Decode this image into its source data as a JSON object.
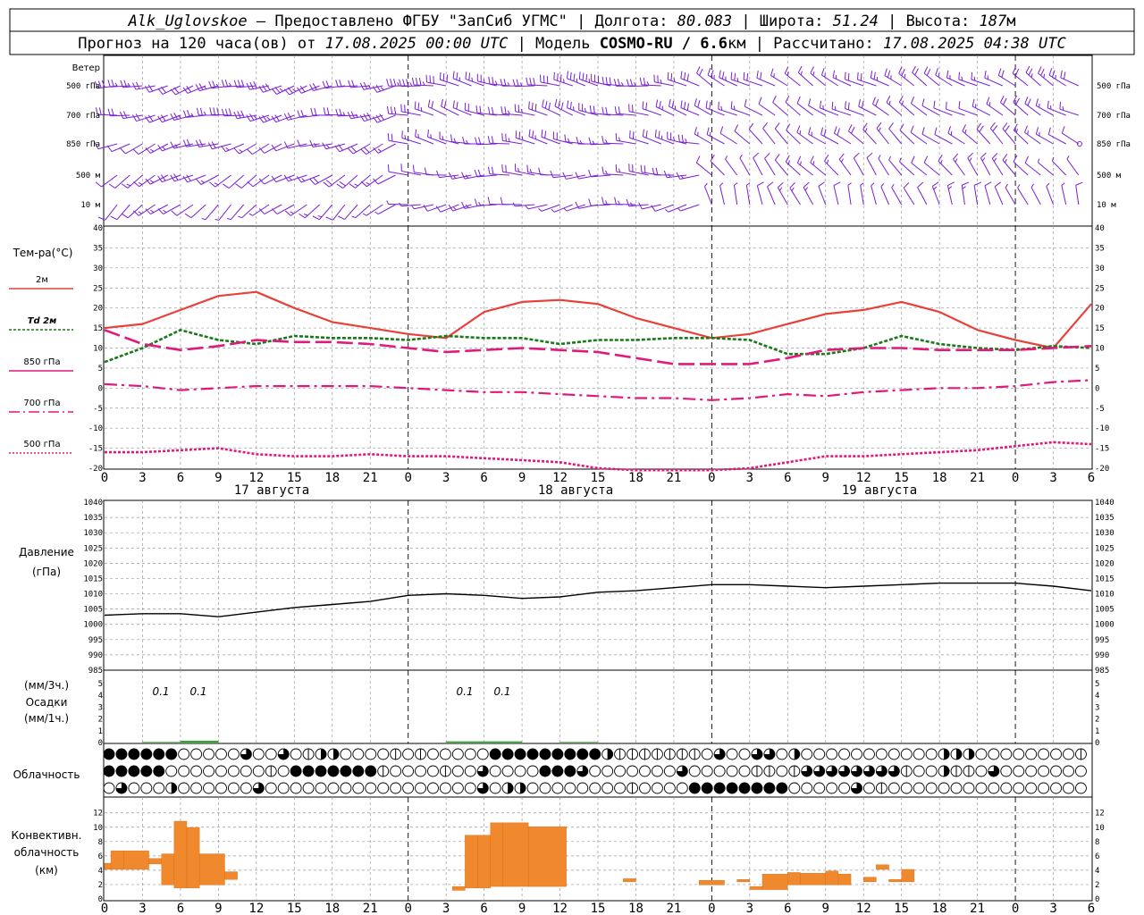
{
  "header": {
    "station": "Alk_Uglovskoe",
    "provider": " – Предоставлено ФГБУ \"ЗапСиб УГМС\" | Долгота: ",
    "lon": "80.083",
    "lat_label": " | Широта: ",
    "lat": "51.24",
    "alt_label": " | Высота: ",
    "alt": "187",
    "alt_unit": "м",
    "line2_a": "Прогноз на 120 часа(ов) от ",
    "run_time": "17.08.2025 00:00 UTC",
    "line2_b": " | Модель ",
    "model": "COSMO-RU / 6.6",
    "model_unit": "км",
    "line2_c": " | Рассчитано: ",
    "calc_time": "17.08.2025 04:38 UTC"
  },
  "wind_panel": {
    "title": "Ветер",
    "levels": [
      "500 гПа",
      "700 гПа",
      "850 гПа",
      "500 м",
      "10 м"
    ],
    "color": "#7a1fd6"
  },
  "temp_panel": {
    "title": "Тем-ра(°C)",
    "legend": [
      {
        "label": "2м",
        "color": "#e8413a"
      },
      {
        "label": "Td 2м",
        "color": "#1a7a1a"
      },
      {
        "label": "850 гПа",
        "color": "#e0197a"
      },
      {
        "label": "700 гПа",
        "color": "#e0197a"
      },
      {
        "label": "500 гПа",
        "color": "#e0197a"
      }
    ],
    "yticks": [
      "40",
      "35",
      "30",
      "25",
      "20",
      "15",
      "10",
      "5",
      "0",
      "-5",
      "-10",
      "-15",
      "-20"
    ]
  },
  "pressure_panel": {
    "title1": "Давление",
    "title2": "(гПа)",
    "yticks": [
      "1040",
      "1035",
      "1030",
      "1025",
      "1020",
      "1015",
      "1010",
      "1005",
      "1000",
      "995",
      "990",
      "985"
    ]
  },
  "precip_panel": {
    "title1": "(мм/3ч.)",
    "title2": "Осадки",
    "title3": "(мм/1ч.)",
    "yticks": [
      "5",
      "4",
      "3",
      "2",
      "1",
      "0"
    ],
    "labels": [
      "0.1",
      "0.1",
      "0.1",
      "0.1"
    ]
  },
  "cloud_panel": {
    "title": "Облачность"
  },
  "conv_panel": {
    "title1": "Конвективн.",
    "title2": "облачность",
    "title3": "(км)",
    "yticks": [
      "12",
      "10",
      "8",
      "6",
      "4",
      "2",
      "0"
    ],
    "color": "#f0892e"
  },
  "x_axis": {
    "ticks": [
      "0",
      "3",
      "6",
      "9",
      "12",
      "15",
      "18",
      "21",
      "0",
      "3",
      "6",
      "9",
      "12",
      "15",
      "18",
      "21",
      "0",
      "3",
      "6",
      "9",
      "12",
      "15",
      "18",
      "21",
      "0",
      "3",
      "6"
    ],
    "days": [
      "17 августа",
      "18 августа",
      "19 августа"
    ]
  },
  "chart_data": [
    {
      "type": "line",
      "title": "Тем-ра(°C)",
      "ylim": [
        -20,
        40
      ],
      "x_hours": [
        0,
        3,
        6,
        9,
        12,
        15,
        18,
        21,
        24,
        27,
        30,
        33,
        36,
        39,
        42,
        45,
        48,
        51,
        54,
        57,
        60,
        63,
        66,
        69,
        72,
        75,
        78
      ],
      "series": [
        {
          "name": "2м",
          "values": [
            15,
            16,
            19.5,
            23,
            24,
            20,
            16.5,
            15,
            13.5,
            12.5,
            19,
            21.5,
            22,
            21,
            17.5,
            15,
            12.5,
            13.5,
            16,
            18.5,
            19.5,
            21.5,
            19,
            14.5,
            12,
            10,
            21
          ]
        },
        {
          "name": "Td 2м",
          "values": [
            6.5,
            10,
            14.5,
            12,
            11,
            13,
            12.5,
            12.5,
            12,
            13,
            12.5,
            12.5,
            11,
            12,
            12,
            12.5,
            12.5,
            12,
            8.5,
            8.5,
            10,
            13,
            11,
            10,
            9.5,
            10.5,
            10
          ]
        },
        {
          "name": "850 гПа",
          "values": [
            14.5,
            11,
            9.5,
            10.5,
            12,
            11.5,
            11.5,
            11,
            10,
            9,
            9.5,
            10,
            9.5,
            9,
            7.5,
            6,
            6,
            6,
            7.5,
            9.5,
            10,
            10,
            9.5,
            9.5,
            9.5,
            10,
            10.5
          ]
        },
        {
          "name": "700 гПа",
          "values": [
            1,
            0.5,
            -0.5,
            0,
            0.5,
            0.5,
            0.5,
            0.5,
            0,
            -0.5,
            -1,
            -1,
            -1.5,
            -2,
            -2.5,
            -2.5,
            -3,
            -2.5,
            -1.5,
            -2,
            -1,
            -0.5,
            0,
            0,
            0.5,
            1.5,
            2
          ]
        },
        {
          "name": "500 гПа",
          "values": [
            -16,
            -16,
            -15.5,
            -15,
            -16.5,
            -17,
            -17,
            -16.5,
            -17,
            -17,
            -17.5,
            -18,
            -18.5,
            -20,
            -21,
            -21,
            -21,
            -20,
            -18.5,
            -17,
            -17,
            -16.5,
            -16,
            -15.5,
            -14.5,
            -13.5,
            -14
          ]
        }
      ]
    },
    {
      "type": "line",
      "title": "Давление",
      "ylabel": "(гПа)",
      "ylim": [
        985,
        1040
      ],
      "x_hours": [
        0,
        3,
        6,
        9,
        12,
        15,
        18,
        21,
        24,
        27,
        30,
        33,
        36,
        39,
        42,
        45,
        48,
        51,
        54,
        57,
        60,
        63,
        66,
        69,
        72,
        75,
        78
      ],
      "values": [
        1003,
        1003.5,
        1003.5,
        1002.5,
        1004,
        1005.5,
        1006.5,
        1007.5,
        1009.5,
        1010,
        1009.5,
        1008.5,
        1009,
        1010.5,
        1011,
        1012,
        1013,
        1013,
        1012.5,
        1012,
        1012.5,
        1013,
        1013.5,
        1013.5,
        1013.5,
        1012.5,
        1011
      ]
    },
    {
      "type": "bar",
      "title": "Осадки",
      "ylabel": "(мм/3ч.)",
      "ylim": [
        0,
        5
      ],
      "x_hours": [
        3,
        6,
        27,
        30,
        36
      ],
      "values": [
        0.05,
        0.15,
        0.1,
        0.1,
        0.05
      ],
      "labels": [
        {
          "x_hour": 4.5,
          "text": "0.1"
        },
        {
          "x_hour": 7.5,
          "text": "0.1"
        },
        {
          "x_hour": 28.5,
          "text": "0.1"
        },
        {
          "x_hour": 31.5,
          "text": "0.1"
        }
      ]
    },
    {
      "type": "bar",
      "title": "Конвективн. облачность",
      "ylabel": "(км)",
      "ylim": [
        0,
        13
      ],
      "bars": [
        {
          "x0": 0,
          "x1": 0.5,
          "bottom": 3.8,
          "top": 4.6
        },
        {
          "x0": 0.5,
          "x1": 1.5,
          "bottom": 3.8,
          "top": 6.2
        },
        {
          "x0": 1.5,
          "x1": 3.5,
          "bottom": 3.8,
          "top": 6.2
        },
        {
          "x0": 3.5,
          "x1": 4.5,
          "bottom": 4.5,
          "top": 5.2
        },
        {
          "x0": 4.5,
          "x1": 5.5,
          "bottom": 1.8,
          "top": 5.8
        },
        {
          "x0": 5.5,
          "x1": 6.5,
          "bottom": 1.4,
          "top": 10
        },
        {
          "x0": 6.5,
          "x1": 7.5,
          "bottom": 1.4,
          "top": 9.2
        },
        {
          "x0": 7.5,
          "x1": 9.5,
          "bottom": 1.8,
          "top": 5.8
        },
        {
          "x0": 9.5,
          "x1": 10.5,
          "bottom": 2.5,
          "top": 3.5
        },
        {
          "x0": 27.5,
          "x1": 28.5,
          "bottom": 1.1,
          "top": 1.6
        },
        {
          "x0": 28.5,
          "x1": 29.5,
          "bottom": 1.4,
          "top": 8.2
        },
        {
          "x0": 29.5,
          "x1": 30.5,
          "bottom": 1.4,
          "top": 8.2
        },
        {
          "x0": 30.5,
          "x1": 31.5,
          "bottom": 1.6,
          "top": 9.8
        },
        {
          "x0": 31.5,
          "x1": 33.5,
          "bottom": 1.6,
          "top": 9.8
        },
        {
          "x0": 33.5,
          "x1": 36.5,
          "bottom": 1.6,
          "top": 9.3
        },
        {
          "x0": 41,
          "x1": 42,
          "bottom": 2.2,
          "top": 2.6
        },
        {
          "x0": 47,
          "x1": 49,
          "bottom": 1.8,
          "top": 2.4
        },
        {
          "x0": 50,
          "x1": 51,
          "bottom": 2.2,
          "top": 2.5
        },
        {
          "x0": 51,
          "x1": 52,
          "bottom": 1.2,
          "top": 1.6
        },
        {
          "x0": 52,
          "x1": 54,
          "bottom": 1.2,
          "top": 3.2
        },
        {
          "x0": 54,
          "x1": 55,
          "bottom": 1.8,
          "top": 3.4
        },
        {
          "x0": 55,
          "x1": 57,
          "bottom": 1.8,
          "top": 3.3
        },
        {
          "x0": 57,
          "x1": 58,
          "bottom": 1.8,
          "top": 3.6
        },
        {
          "x0": 58,
          "x1": 59,
          "bottom": 1.8,
          "top": 3.2
        },
        {
          "x0": 60,
          "x1": 61,
          "bottom": 2.2,
          "top": 2.8
        },
        {
          "x0": 61,
          "x1": 62,
          "bottom": 3.8,
          "top": 4.4
        },
        {
          "x0": 62,
          "x1": 63,
          "bottom": 2.2,
          "top": 2.5
        },
        {
          "x0": 63,
          "x1": 64,
          "bottom": 2.2,
          "top": 3.8
        }
      ]
    }
  ]
}
